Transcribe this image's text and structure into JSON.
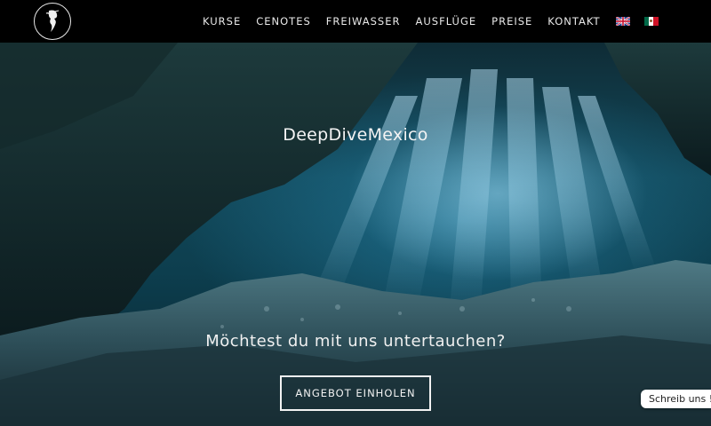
{
  "nav": {
    "items": [
      {
        "label": "KURSE"
      },
      {
        "label": "CENOTES"
      },
      {
        "label": "FREIWASSER"
      },
      {
        "label": "AUSFLÜGE"
      },
      {
        "label": "PREISE"
      },
      {
        "label": "KONTAKT"
      }
    ],
    "flags": [
      "uk-flag-icon",
      "mexico-flag-icon"
    ]
  },
  "logo": {
    "icon": "seahorse-logo-icon"
  },
  "hero": {
    "title": "DeepDiveMexico",
    "subtitle": "Möchtest du mit uns untertauchen?",
    "cta_label": "ANGEBOT EINHOLEN"
  },
  "chat": {
    "label": "Schreib uns !"
  },
  "colors": {
    "header_bg": "#000000",
    "nav_text": "#e9e9e9",
    "water_dark": "#0d3e4e",
    "water_light": "#7fcde6"
  }
}
